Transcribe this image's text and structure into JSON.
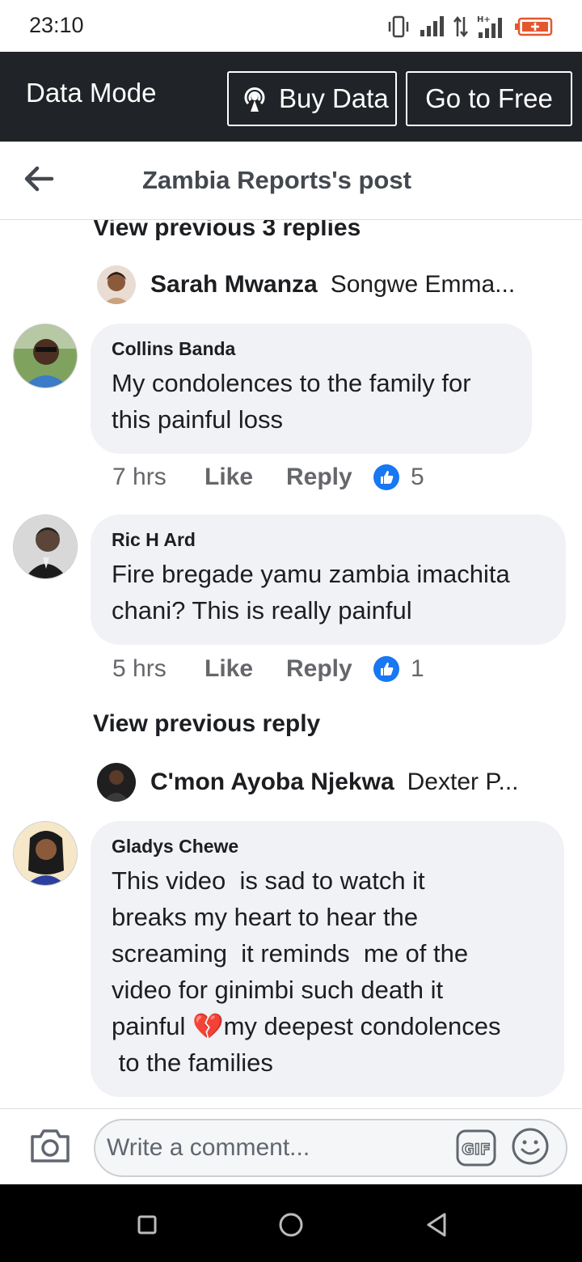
{
  "status_bar": {
    "time": "23:10"
  },
  "data_bar": {
    "title": "Data Mode",
    "buy_label": "Buy Data",
    "free_label": "Go to Free"
  },
  "header": {
    "title": "Zambia Reports's post"
  },
  "thread1": {
    "view_previous": "View previous 3 replies",
    "last_reply": {
      "name": "Sarah Mwanza",
      "preview": "Songwe Emma..."
    }
  },
  "comments": [
    {
      "name": "Collins Banda",
      "text": "My condolences to the family for\nthis painful loss",
      "time": "7 hrs",
      "like": "Like",
      "reply": "Reply",
      "reactions": "5"
    },
    {
      "name": "Ric H Ard",
      "text": "Fire bregade yamu zambia imachita\nchani? This is really painful",
      "time": "5 hrs",
      "like": "Like",
      "reply": "Reply",
      "reactions": "1"
    },
    {
      "name": "Gladys Chewe",
      "text_before_emoji": "This video  is sad to watch it\nbreaks my heart to hear the\nscreaming  it reminds  me of the\nvideo for ginimbi such death it\npainful ",
      "emoji": "💔",
      "text_after_emoji": "my deepest condolences\n to the families"
    }
  ],
  "thread2": {
    "view_previous": "View previous reply",
    "last_reply": {
      "name": "C'mon Ayoba Njekwa",
      "preview": "Dexter P..."
    }
  },
  "composer": {
    "placeholder": "Write a comment..."
  },
  "colors": {
    "like_blue": "#1877f2",
    "data_bar": "#202327",
    "bubble": "#f0f2f5"
  }
}
